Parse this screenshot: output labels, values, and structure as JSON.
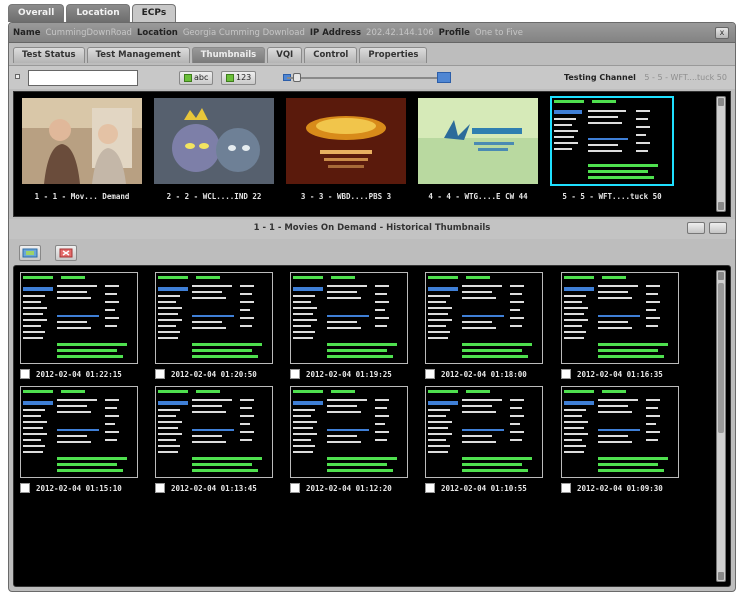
{
  "top_tabs": [
    "Overall",
    "Location",
    "ECPs"
  ],
  "info": {
    "name_label": "Name",
    "name_value": "CummingDownRoad",
    "location_label": "Location",
    "location_value": "Georgia Cumming Download",
    "ip_label": "IP Address",
    "ip_value": "202.42.144.106",
    "profile_label": "Profile",
    "profile_value": "One to Five",
    "close_label": "x"
  },
  "subtabs": [
    "Test Status",
    "Test Management",
    "Thumbnails",
    "VQI",
    "Control",
    "Properties"
  ],
  "toolbar": {
    "search_value": "",
    "btn_abc": "abc",
    "btn_123": "123",
    "testing_channel_label": "Testing Channel",
    "testing_channel_value": "5 - 5 - WFT....tuck 50"
  },
  "channels": [
    {
      "label": "1 - 1 - Mov... Demand"
    },
    {
      "label": "2 - 2 - WCL....IND 22"
    },
    {
      "label": "3 - 3 - WBD....PBS 3"
    },
    {
      "label": "4 - 4 - WTG....E CW 44"
    },
    {
      "label": "5 - 5 - WFT....tuck 50"
    }
  ],
  "history": {
    "title": "1 - 1 - Movies On Demand - Historical Thumbnails",
    "timestamps": [
      "2012-02-04 01:22:15",
      "2012-02-04 01:20:50",
      "2012-02-04 01:19:25",
      "2012-02-04 01:18:00",
      "2012-02-04 01:16:35",
      "2012-02-04 01:15:10",
      "2012-02-04 01:13:45",
      "2012-02-04 01:12:20",
      "2012-02-04 01:10:55",
      "2012-02-04 01:09:30"
    ]
  },
  "colors": {
    "selection": "#1fe0ff",
    "guide_blue": "#3f7fd6",
    "guide_green": "#4fe04f"
  }
}
